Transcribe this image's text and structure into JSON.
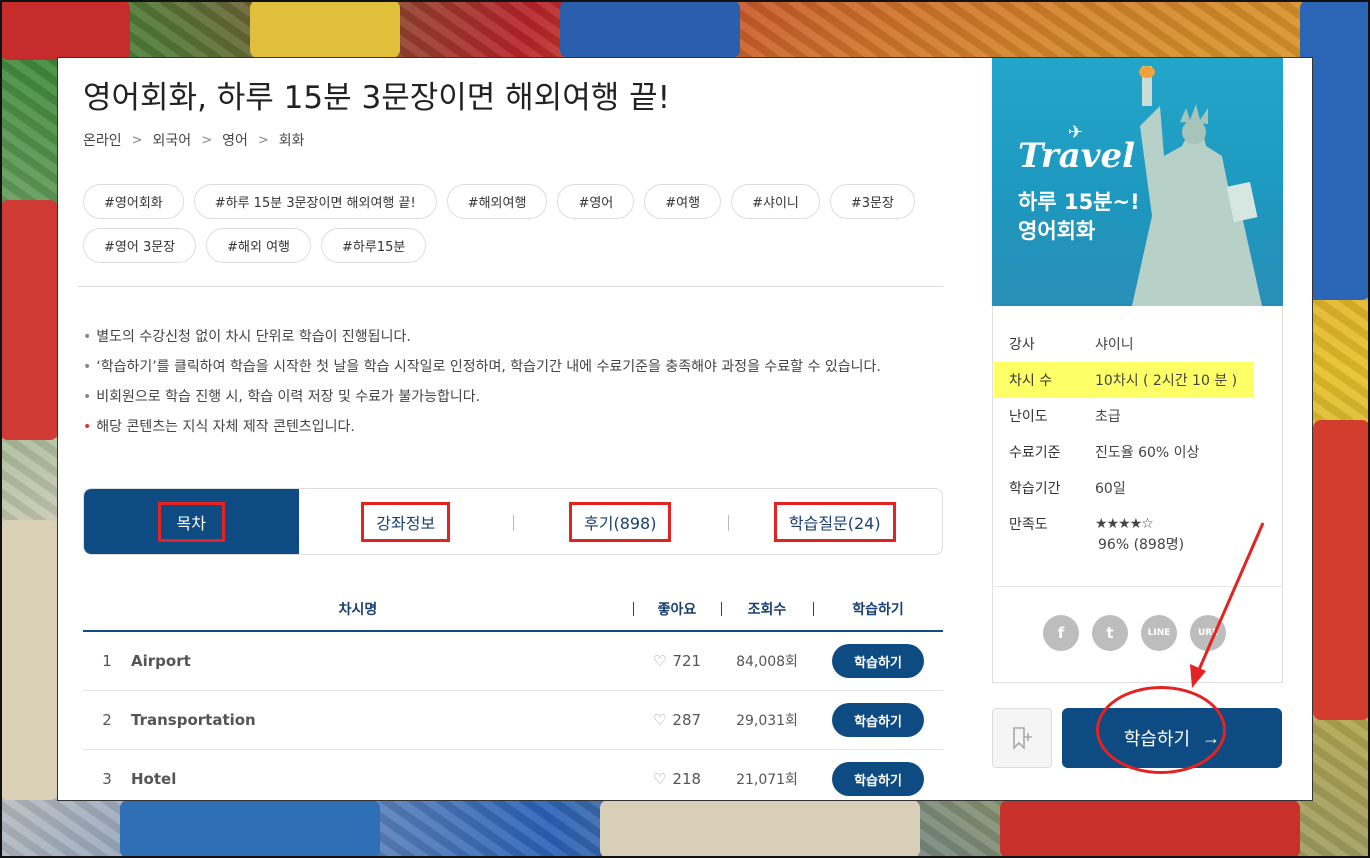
{
  "course": {
    "title": "영어회화, 하루 15분 3문장이면 해외여행 끝!",
    "breadcrumb": [
      "온라인",
      "외국어",
      "영어",
      "회화"
    ],
    "tags": [
      "#영어회화",
      "#하루 15분 3문장이면 해외여행 끝!",
      "#해외여행",
      "#영어",
      "#여행",
      "#샤이니",
      "#3문장",
      "#영어 3문장",
      "#해외 여행",
      "#하루15분"
    ],
    "notes": [
      "별도의 수강신청 없이 차시 단위로 학습이 진행됩니다.",
      "‘학습하기’를 클릭하여 학습을 시작한 첫 날을 학습 시작일로 인정하며, 학습기간 내에 수료기준을 충족해야 과정을 수료할 수 있습니다.",
      "비회원으로 학습 진행 시, 학습 이력 저장 및 수료가 불가능합니다.",
      "해당 콘텐츠는 지식 자체 제작 콘텐츠입니다."
    ]
  },
  "tabs": [
    "목차",
    "강좌정보",
    "후기(898)",
    "학습질문(24)"
  ],
  "table": {
    "headers": {
      "name": "차시명",
      "likes": "좋아요",
      "views": "조회수",
      "action": "학습하기"
    },
    "rows": [
      {
        "num": "1",
        "name": "Airport",
        "likes": "721",
        "views": "84,008회",
        "action": "학습하기"
      },
      {
        "num": "2",
        "name": "Transportation",
        "likes": "287",
        "views": "29,031회",
        "action": "학습하기"
      },
      {
        "num": "3",
        "name": "Hotel",
        "likes": "218",
        "views": "21,071회",
        "action": "학습하기"
      }
    ]
  },
  "thumbnail": {
    "script": "Travel",
    "line1": "하루 15분~!",
    "line2": "영어회화"
  },
  "info": {
    "instructor": {
      "label": "강사",
      "value": "샤이니"
    },
    "sessions": {
      "label": "차시 수",
      "value": "10차시 ( 2시간 10 분 )"
    },
    "level": {
      "label": "난이도",
      "value": "초급"
    },
    "criteria": {
      "label": "수료기준",
      "value": "진도율 60% 이상"
    },
    "period": {
      "label": "학습기간",
      "value": "60일"
    },
    "satisfaction": {
      "label": "만족도",
      "stars": "★★★★☆",
      "value": "96% (898명)"
    }
  },
  "sns": [
    "f",
    "t",
    "LINE",
    "URL"
  ],
  "cta": {
    "label": "학습하기",
    "arrow": "→"
  },
  "colors": {
    "primary": "#0d4b82",
    "highlight": "#ffff66",
    "annotation": "#e32222"
  }
}
